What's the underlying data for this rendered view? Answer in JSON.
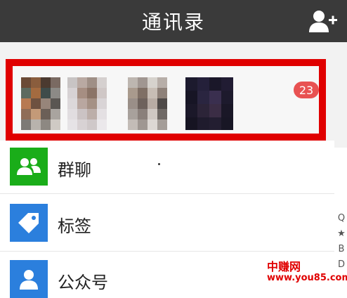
{
  "header": {
    "title": "通讯录",
    "add_friend_icon": "add-contact-icon"
  },
  "new_friends": {
    "badge_count": "23"
  },
  "menu": [
    {
      "label": "群聊",
      "icon": "group-chat-icon",
      "icon_bg": "#1aad19"
    },
    {
      "label": "标签",
      "icon": "tag-icon",
      "icon_bg": "#2b7fdd"
    },
    {
      "label": "公众号",
      "icon": "official-account-icon",
      "icon_bg": "#2b7fdd"
    }
  ],
  "side_index": [
    "Q",
    "★",
    "B",
    "D"
  ],
  "watermark": {
    "line1": "中赚网",
    "line2": "www.you85.com"
  },
  "colors": {
    "header_bg": "#3a3a3a",
    "highlight_frame": "#e00000",
    "badge": "#e85252"
  }
}
